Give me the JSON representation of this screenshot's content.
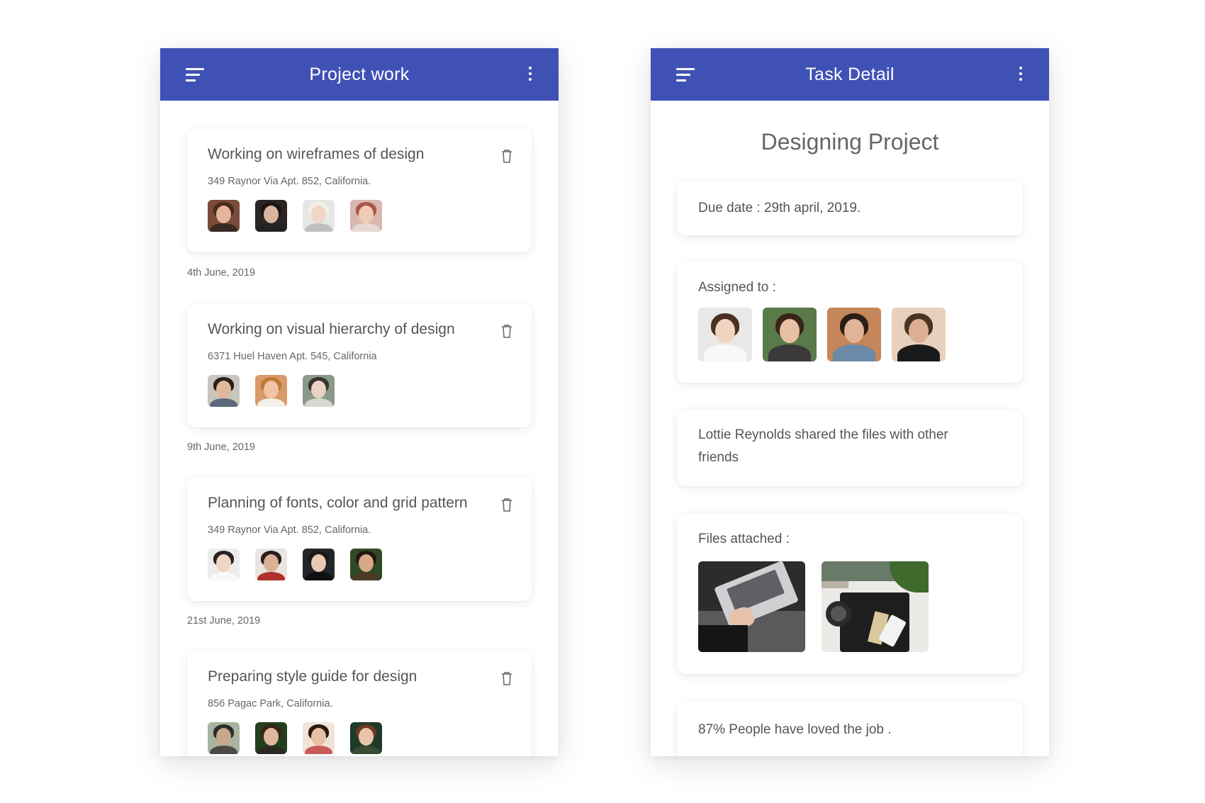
{
  "left_screen": {
    "title": "Project work",
    "tasks": [
      {
        "title": "Working on wireframes of design",
        "address": "349 Raynor Via Apt. 852, California.",
        "avatars": [
          {
            "bg": "#7a4a3a",
            "skin": "#e6b49c",
            "hair": "#4a2a1c",
            "body": "#3a2a24"
          },
          {
            "bg": "#2a2424",
            "skin": "#d9b5a0",
            "hair": "#1a1414",
            "body": "#222"
          },
          {
            "bg": "#e6e6e6",
            "skin": "#efd6c8",
            "hair": "#f2efe6",
            "body": "#bfbfbf"
          },
          {
            "bg": "#d8b8b0",
            "skin": "#f0cbb8",
            "hair": "#a8584a",
            "body": "#e8d8d4"
          }
        ]
      },
      {
        "title": "Working on visual hierarchy of design",
        "address": "6371 Huel Haven Apt. 545, California",
        "avatars": [
          {
            "bg": "#c8c4be",
            "skin": "#e0b89c",
            "hair": "#2a2018",
            "body": "#5a6a7a"
          },
          {
            "bg": "#d89a6a",
            "skin": "#f0c4a4",
            "hair": "#c07838",
            "body": "#f4efe8"
          },
          {
            "bg": "#8a9a8a",
            "skin": "#e8d4c4",
            "hair": "#3a342c",
            "body": "#d8d8d0"
          }
        ]
      },
      {
        "title": "Planning of fonts, color and grid pattern",
        "address": "349 Raynor Via Apt. 852, California.",
        "avatars": [
          {
            "bg": "#ececec",
            "skin": "#efd6c4",
            "hair": "#2a2220",
            "body": "#f8f8f8"
          },
          {
            "bg": "#e8e4e0",
            "skin": "#dcb096",
            "hair": "#2a1c18",
            "body": "#b0302a"
          },
          {
            "bg": "#22262a",
            "skin": "#e8c8b4",
            "hair": "#1c1816",
            "body": "#101010"
          },
          {
            "bg": "#2e4a26",
            "skin": "#d8a888",
            "hair": "#24180f",
            "body": "#4a3a28"
          }
        ]
      },
      {
        "title": "Preparing style guide for design",
        "address": "856 Pagac Park, California.",
        "avatars": [
          {
            "bg": "#a8b4a0",
            "skin": "#caa68c",
            "hair": "#2c2c2c",
            "body": "#4a4a48"
          },
          {
            "bg": "#23401e",
            "skin": "#e0b89c",
            "hair": "#3a2414",
            "body": "#2a2a22"
          },
          {
            "bg": "#f0e4d8",
            "skin": "#eac0a4",
            "hair": "#2a1a12",
            "body": "#c85a5a"
          },
          {
            "bg": "#1e3a28",
            "skin": "#e8c4ac",
            "hair": "#6a3a22",
            "body": "#3a4a30"
          }
        ]
      }
    ],
    "dates": [
      "4th June, 2019",
      "9th June, 2019",
      "21st June, 2019"
    ]
  },
  "right_screen": {
    "title": "Task Detail",
    "heading": "Designing Project",
    "due_date": "Due date : 29th april, 2019.",
    "assigned_label": "Assigned to :",
    "assignees": [
      {
        "bg": "#e8e8e6",
        "skin": "#f0d4c0",
        "hair": "#4a3022",
        "body": "#f8f8f8"
      },
      {
        "bg": "#5a7a4a",
        "skin": "#e8c0a4",
        "hair": "#3a2418",
        "body": "#3a3a3a"
      },
      {
        "bg": "#c4865a",
        "skin": "#e0b498",
        "hair": "#2a1e16",
        "body": "#6a8aa8"
      },
      {
        "bg": "#e8d0bc",
        "skin": "#dcae92",
        "hair": "#4a3426",
        "body": "#1a1a1a"
      }
    ],
    "shared_line1": "Lottie Reynolds shared the files with other",
    "shared_line2": "friends",
    "files_label": "Files attached :",
    "love_text": "87% People have loved the job ."
  },
  "colors": {
    "appbar": "#4051b5",
    "card_bg": "#ffffff"
  }
}
